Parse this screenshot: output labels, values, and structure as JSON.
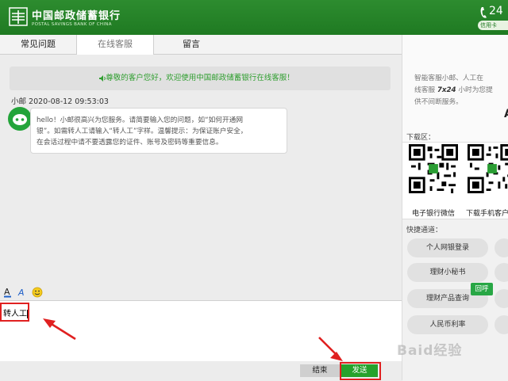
{
  "app": {
    "brand_cn": "中国邮政储蓄银行",
    "brand_en": "POSTAL SAVINGS BANK OF CHINA",
    "hotline_number": "24",
    "hotline_label": "信用卡"
  },
  "tabs": [
    {
      "label": "常见问题"
    },
    {
      "label": "在线客服"
    },
    {
      "label": "留言"
    }
  ],
  "chat": {
    "notice": "尊敬的客户您好，欢迎使用中国邮政储蓄银行在线客服！",
    "sender": "小邮 2020-08-12 09:53:03",
    "message_line1": "hello！小邮很高兴为您服务。请简要输入您的问题，如“如何开通网",
    "message_line2": "银”。如需转人工请输入“转人工”字样。温馨提示：为保证账户安全，",
    "message_line3": "在会话过程中请不要透露您的证件、账号及密码等重要信息。"
  },
  "input": {
    "value": "转人工"
  },
  "buttons": {
    "end": "结束",
    "send": "发送"
  },
  "sidebar": {
    "intro_line1": "智能客服小邮、人工在",
    "intro_line2_prefix": "线客服",
    "intro_line2_bold": "7x24",
    "intro_line2_suffix": "小时为您提",
    "intro_line3": "供不间断服务。",
    "clipped_A": "A",
    "download_title": "下载区：",
    "qr1_label": "电子银行微信",
    "qr2_label": "下载手机客户",
    "quick_title": "快捷通道：",
    "quick_items": [
      "个人网银登录",
      "理财小秘书",
      "理财产品查询",
      "人民币利率"
    ],
    "callback": "回呼"
  },
  "watermark": "Baid经验",
  "colors": {
    "brand_green": "#1f7a22",
    "send_green": "#26a22c",
    "highlight_red": "#e02020"
  }
}
